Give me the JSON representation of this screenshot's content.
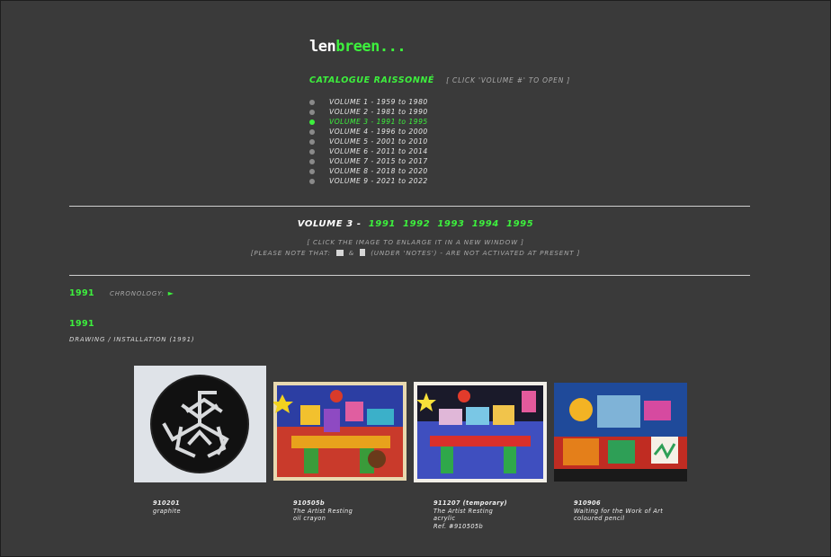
{
  "logo": {
    "part1": "len",
    "part2": "breen..."
  },
  "catalogue": {
    "title": "CATALOGUE RAISSONNÉ",
    "note": "[ CLICK 'VOLUME #' TO OPEN ]"
  },
  "volumes": [
    {
      "label": "VOLUME 1 - 1959 to 1980",
      "active": false
    },
    {
      "label": "VOLUME 2 - 1981 to 1990",
      "active": false
    },
    {
      "label": "VOLUME 3 - 1991 to 1995",
      "active": true
    },
    {
      "label": "VOLUME 4 - 1996 to 2000",
      "active": false
    },
    {
      "label": "VOLUME 5 - 2001 to 2010",
      "active": false
    },
    {
      "label": "VOLUME 6 - 2011 to 2014",
      "active": false
    },
    {
      "label": "VOLUME 7 - 2015 to 2017",
      "active": false
    },
    {
      "label": "VOLUME 8 - 2018 to 2020",
      "active": false
    },
    {
      "label": "VOLUME 9 - 2021 to 2022",
      "active": false
    }
  ],
  "volume_header": {
    "prefix": "VOLUME 3 -",
    "years": [
      "1991",
      "1992",
      "1993",
      "1994",
      "1995"
    ]
  },
  "notes": {
    "click_image": "[ CLICK THE IMAGE TO ENLARGE IT IN A NEW WINDOW ]",
    "please_note": "[PLEASE NOTE THAT:",
    "amp": "&",
    "under_notes": "(UNDER 'NOTES') - ARE NOT ACTIVATED AT PRESENT ]"
  },
  "year_section": {
    "year": "1991",
    "chronology_label": "CHRONOLOGY:",
    "arrow": "►"
  },
  "subsection": {
    "year": "1991",
    "title": "DRAWING / INSTALLATION (1991)"
  },
  "colors": {
    "accent": "#3df03d",
    "background": "#3a3a3a"
  },
  "artworks": [
    {
      "id": "910201",
      "lines": [
        "graphite"
      ]
    },
    {
      "id": "910505b",
      "lines": [
        "The Artist Resting",
        "oil crayon"
      ]
    },
    {
      "id": "911207 (temporary)",
      "lines": [
        "The Artist Resting",
        "acrylic",
        "Ref. #910505b"
      ]
    },
    {
      "id": "910906",
      "lines": [
        "Waiting for the Work of Art",
        "coloured pencil"
      ]
    }
  ]
}
